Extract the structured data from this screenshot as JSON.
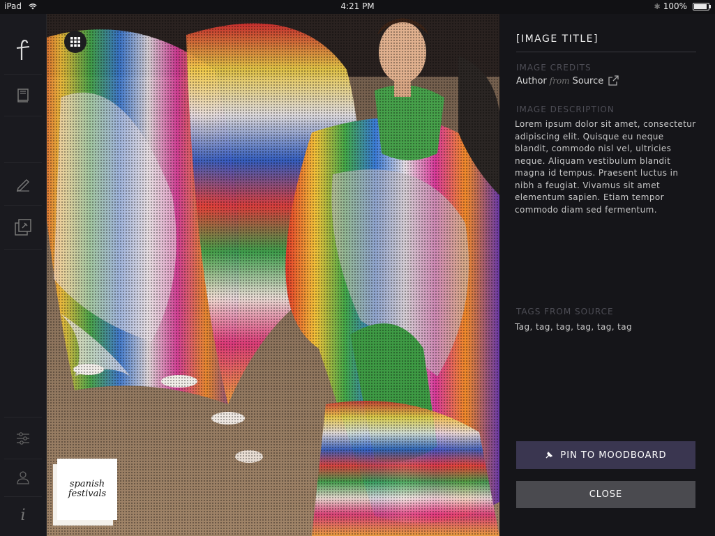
{
  "status_bar": {
    "device": "iPad",
    "time": "4:21 PM",
    "battery": "100%",
    "battery_level": 1.0
  },
  "sidebar": {
    "items": [
      {
        "icon": "feather-logo-icon"
      },
      {
        "icon": "book-icon"
      },
      {
        "icon": "blank"
      },
      {
        "icon": "pen-icon"
      },
      {
        "icon": "moodboard-pin-icon"
      },
      {
        "icon": "sliders-icon"
      },
      {
        "icon": "user-icon"
      },
      {
        "icon": "info-icon"
      }
    ]
  },
  "photo": {
    "grid_icon": "grid-icon",
    "logo_line1": "spanish",
    "logo_line2": "festivals"
  },
  "detail": {
    "title": "[IMAGE TITLE]",
    "credits_label": "IMAGE CREDITS",
    "author": "Author",
    "from": "from",
    "source": "Source",
    "description_label": "IMAGE DESCRIPTION",
    "description": "Lorem ipsum dolor sit amet, consectetur adipiscing elit. Quisque eu neque blandit, commodo nisl vel, ultricies neque. Aliquam vestibulum blandit magna id tempus. Praesent luctus in nibh a feugiat. Vivamus sit amet elementum sapien. Etiam tempor commodo diam sed fermentum.",
    "tags_label": "TAGS FROM SOURCE",
    "tags": "Tag, tag, tag, tag, tag, tag",
    "pin_button": "PIN TO MOODBOARD",
    "close_button": "CLOSE"
  },
  "colors": {
    "background": "#111114",
    "sidebar": "#1a1a1f",
    "panel": "#151519",
    "pin_button": "#3a3650",
    "close_button": "#4a4a4f"
  }
}
